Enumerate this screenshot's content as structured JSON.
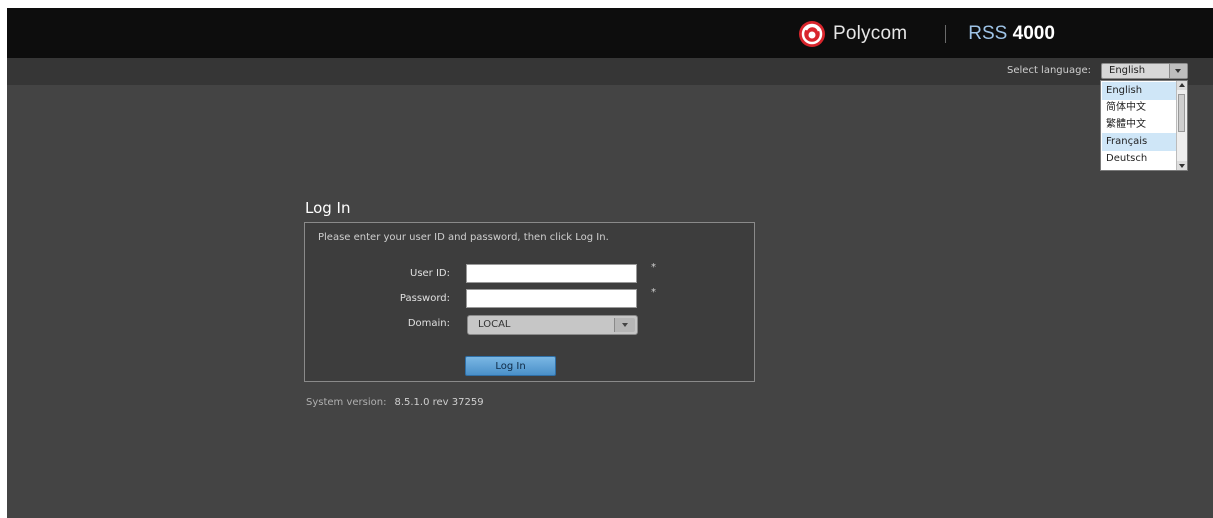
{
  "header": {
    "brand": "Polycom",
    "product_prefix": "RSS",
    "product_number": "4000"
  },
  "language": {
    "label": "Select language:",
    "selected": "English",
    "options": [
      "English",
      "简体中文",
      "繁體中文",
      "Français",
      "Deutsch"
    ]
  },
  "login": {
    "title": "Log In",
    "instruction": "Please enter your user ID and password, then click Log In.",
    "user_id_label": "User ID:",
    "user_id_value": "",
    "password_label": "Password:",
    "password_value": "",
    "required_marker": "*",
    "domain_label": "Domain:",
    "domain_value": "LOCAL",
    "submit_label": "Log In"
  },
  "system": {
    "version_label": "System version:",
    "version_value": "8.5.1.0 rev 37259"
  },
  "colors": {
    "page_bg": "#444444",
    "topbar_bg": "#0d0d0d",
    "accent": "#4a90c9",
    "product_prefix": "#9ec3e6"
  },
  "icons": {
    "logo": "polycom-logo-icon",
    "dropdown": "chevron-down-icon",
    "scroll_up": "chevron-up-icon"
  }
}
